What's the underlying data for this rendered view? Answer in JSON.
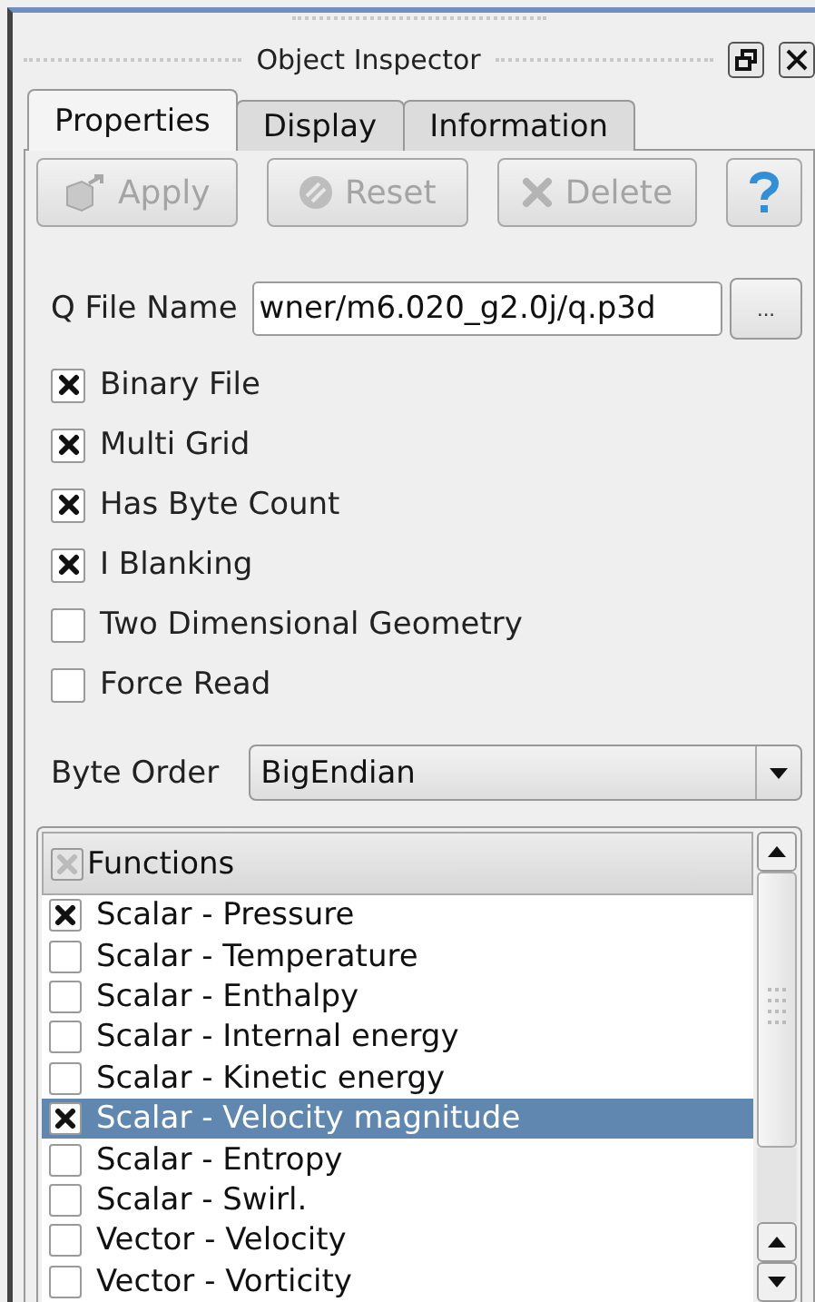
{
  "window": {
    "title": "Object Inspector"
  },
  "tabs": [
    {
      "label": "Properties",
      "selected": true
    },
    {
      "label": "Display",
      "selected": false
    },
    {
      "label": "Information",
      "selected": false
    }
  ],
  "buttons": [
    {
      "kind": "apply",
      "label": "Apply",
      "disabled": true
    },
    {
      "kind": "reset",
      "label": "Reset",
      "disabled": true
    },
    {
      "kind": "delete",
      "label": "Delete",
      "disabled": true
    },
    {
      "kind": "help"
    }
  ],
  "file_name": {
    "label": "Q File Name",
    "value": "wner/m6.020_g2.0j/q.p3d",
    "browse": "..."
  },
  "options": [
    {
      "label": "Binary File",
      "checked": true
    },
    {
      "label": "Multi Grid",
      "checked": true
    },
    {
      "label": "Has Byte Count",
      "checked": true
    },
    {
      "label": "I Blanking",
      "checked": true
    },
    {
      "label": "Two Dimensional Geometry",
      "checked": false
    },
    {
      "label": "Force Read",
      "checked": false
    }
  ],
  "byte_order": {
    "label": "Byte Order",
    "value": "BigEndian"
  },
  "functions": {
    "header": "Functions",
    "header_checked": true,
    "items": [
      {
        "label": "Scalar - Pressure",
        "checked": true,
        "selected": false
      },
      {
        "label": "Scalar - Temperature",
        "checked": false,
        "selected": false
      },
      {
        "label": "Scalar - Enthalpy",
        "checked": false,
        "selected": false
      },
      {
        "label": "Scalar - Internal energy",
        "checked": false,
        "selected": false
      },
      {
        "label": "Scalar - Kinetic energy",
        "checked": false,
        "selected": false
      },
      {
        "label": "Scalar - Velocity magnitude",
        "checked": true,
        "selected": true
      },
      {
        "label": "Scalar - Entropy",
        "checked": false,
        "selected": false
      },
      {
        "label": "Scalar - Swirl.",
        "checked": false,
        "selected": false
      },
      {
        "label": "Vector - Velocity",
        "checked": false,
        "selected": false
      },
      {
        "label": "Vector - Vorticity",
        "checked": false,
        "selected": false
      }
    ]
  }
}
